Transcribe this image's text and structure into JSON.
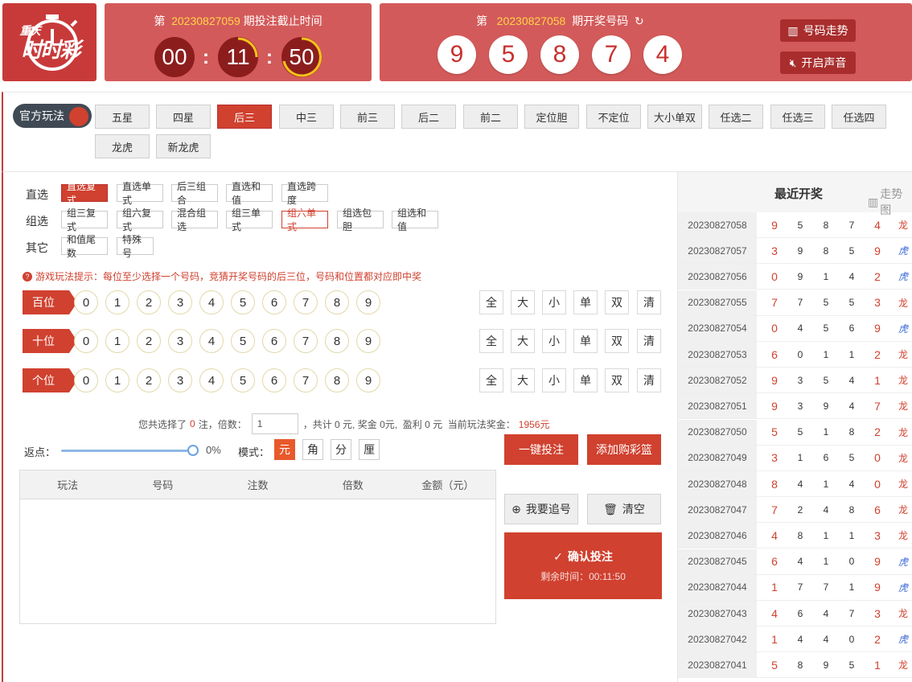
{
  "header": {
    "logo_text_top": "重庆",
    "logo_text_main": "时时彩",
    "countdown": {
      "prefix": "第",
      "issue": "20230827059",
      "suffix": "期投注截止时间",
      "hours": "00",
      "minutes": "11",
      "seconds": "50"
    },
    "last_draw": {
      "prefix": "第",
      "issue": "20230827058",
      "suffix": "期开奖号码",
      "refresh_icon": "refresh-icon",
      "balls": [
        "9",
        "5",
        "8",
        "7",
        "4"
      ]
    },
    "trend_button": "号码走势",
    "sound_button": "开启声音"
  },
  "play": {
    "toggle_label": "官方玩法",
    "tabs": [
      "五星",
      "四星",
      "后三",
      "中三",
      "前三",
      "后二",
      "前二",
      "定位胆",
      "不定位",
      "大小单双",
      "任选二",
      "任选三",
      "任选四",
      "龙虎",
      "新龙虎"
    ],
    "active_tab": "后三"
  },
  "subtypes": {
    "direct_label": "直选",
    "direct": [
      "直选复式",
      "直选单式",
      "后三组合",
      "直选和值",
      "直选跨度"
    ],
    "group_label": "组选",
    "group": [
      "组三复式",
      "组六复式",
      "混合组选",
      "组三单式",
      "组六单式",
      "组选包胆",
      "组选和值"
    ],
    "other_label": "其它",
    "other": [
      "和值尾数",
      "特殊号"
    ]
  },
  "hint": "游戏玩法提示：每位至少选择一个号码，竞猜开奖号码的后三位，号码和位置都对应即中奖",
  "positions": [
    {
      "label": "百位"
    },
    {
      "label": "十位"
    },
    {
      "label": "个位"
    }
  ],
  "digits": [
    "0",
    "1",
    "2",
    "3",
    "4",
    "5",
    "6",
    "7",
    "8",
    "9"
  ],
  "quick": [
    "全",
    "大",
    "小",
    "单",
    "双",
    "清"
  ],
  "summary": {
    "p1": "您共选择了",
    "count": "0",
    "p2": "注，倍数：",
    "multiplier": "1",
    "p3": "，共计 0 元, 奖金 0元,",
    "p4": "盈利 0 元",
    "p5": "当前玩法奖金：",
    "prize": "1956元"
  },
  "rebate": {
    "label": "返点：",
    "value": "0%"
  },
  "mode": {
    "label": "模式：",
    "options": [
      "元",
      "角",
      "分",
      "厘"
    ],
    "active": "元"
  },
  "bet_table": {
    "headers": [
      "玩法",
      "号码",
      "注数",
      "倍数",
      "金额（元）"
    ]
  },
  "actions": {
    "one_click": "一键投注",
    "add_cart": "添加购彩篮",
    "chase": "我要追号",
    "clear": "清空",
    "confirm": "确认投注",
    "remaining": "剩余时间：00:11:50"
  },
  "sidebar": {
    "title": "最近开奖",
    "trend": "走势图",
    "rows": [
      {
        "issue": "20230827058",
        "n": [
          "9",
          "5",
          "8",
          "7",
          "4"
        ],
        "tag": "龙"
      },
      {
        "issue": "20230827057",
        "n": [
          "3",
          "9",
          "8",
          "5",
          "9"
        ],
        "tag": "虎"
      },
      {
        "issue": "20230827056",
        "n": [
          "0",
          "9",
          "1",
          "4",
          "2"
        ],
        "tag": "虎"
      },
      {
        "issue": "20230827055",
        "n": [
          "7",
          "7",
          "5",
          "5",
          "3"
        ],
        "tag": "龙"
      },
      {
        "issue": "20230827054",
        "n": [
          "0",
          "4",
          "5",
          "6",
          "9"
        ],
        "tag": "虎"
      },
      {
        "issue": "20230827053",
        "n": [
          "6",
          "0",
          "1",
          "1",
          "2"
        ],
        "tag": "龙"
      },
      {
        "issue": "20230827052",
        "n": [
          "9",
          "3",
          "5",
          "4",
          "1"
        ],
        "tag": "龙"
      },
      {
        "issue": "20230827051",
        "n": [
          "9",
          "3",
          "9",
          "4",
          "7"
        ],
        "tag": "龙"
      },
      {
        "issue": "20230827050",
        "n": [
          "5",
          "5",
          "1",
          "8",
          "2"
        ],
        "tag": "龙"
      },
      {
        "issue": "20230827049",
        "n": [
          "3",
          "1",
          "6",
          "5",
          "0"
        ],
        "tag": "龙"
      },
      {
        "issue": "20230827048",
        "n": [
          "8",
          "4",
          "1",
          "4",
          "0"
        ],
        "tag": "龙"
      },
      {
        "issue": "20230827047",
        "n": [
          "7",
          "2",
          "4",
          "8",
          "6"
        ],
        "tag": "龙"
      },
      {
        "issue": "20230827046",
        "n": [
          "4",
          "8",
          "1",
          "1",
          "3"
        ],
        "tag": "龙"
      },
      {
        "issue": "20230827045",
        "n": [
          "6",
          "4",
          "1",
          "0",
          "9"
        ],
        "tag": "虎"
      },
      {
        "issue": "20230827044",
        "n": [
          "1",
          "7",
          "7",
          "1",
          "9"
        ],
        "tag": "虎"
      },
      {
        "issue": "20230827043",
        "n": [
          "4",
          "6",
          "4",
          "7",
          "3"
        ],
        "tag": "龙"
      },
      {
        "issue": "20230827042",
        "n": [
          "1",
          "4",
          "4",
          "0",
          "2"
        ],
        "tag": "虎"
      },
      {
        "issue": "20230827041",
        "n": [
          "5",
          "8",
          "9",
          "5",
          "1"
        ],
        "tag": "龙"
      }
    ]
  },
  "colors": {
    "brand_red": "#d0412f",
    "header_red": "#d35a5a",
    "dragon": "#d0412f",
    "tiger": "#3d6bd6"
  }
}
